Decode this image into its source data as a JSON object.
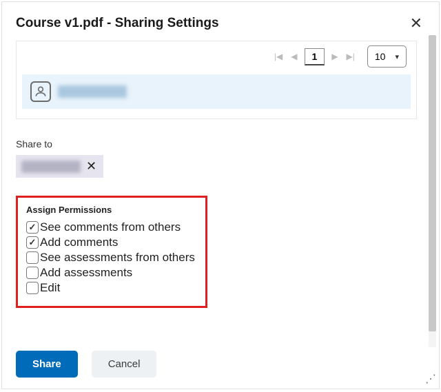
{
  "dialog": {
    "title": "Course v1.pdf - Sharing Settings"
  },
  "pagination": {
    "current_page": "1",
    "page_size": "10"
  },
  "share_to": {
    "label": "Share to"
  },
  "permissions": {
    "title": "Assign Permissions",
    "items": [
      {
        "label": "See comments from others",
        "checked": true
      },
      {
        "label": "Add comments",
        "checked": true
      },
      {
        "label": "See assessments from others",
        "checked": false
      },
      {
        "label": "Add assessments",
        "checked": false
      },
      {
        "label": "Edit",
        "checked": false
      }
    ]
  },
  "buttons": {
    "share": "Share",
    "cancel": "Cancel"
  }
}
